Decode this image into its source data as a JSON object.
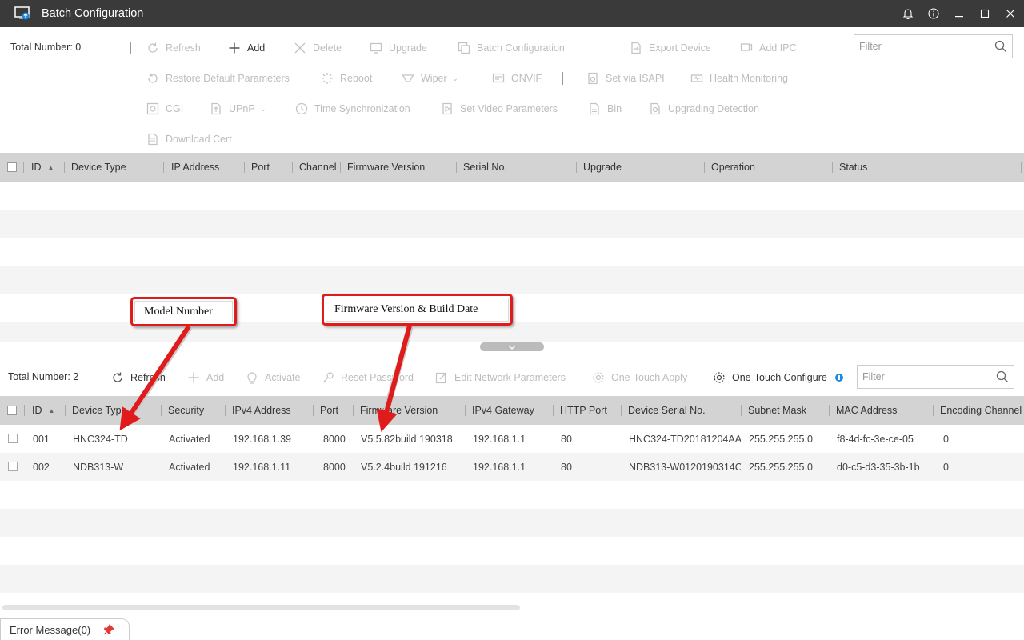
{
  "window": {
    "title": "Batch Configuration"
  },
  "top_section": {
    "total_label": "Total Number: 0",
    "toolbar": {
      "refresh": "Refresh",
      "add": "Add",
      "delete": "Delete",
      "upgrade": "Upgrade",
      "batch_configuration": "Batch Configuration",
      "export_device": "Export Device",
      "add_ipc": "Add IPC",
      "restore_default": "Restore Default Parameters",
      "reboot": "Reboot",
      "wiper": "Wiper",
      "onvif": "ONVIF",
      "set_via_isapi": "Set via ISAPI",
      "health_monitoring": "Health Monitoring",
      "cgi": "CGI",
      "upnp": "UPnP",
      "time_sync": "Time Synchronization",
      "set_video_params": "Set Video Parameters",
      "bin": "Bin",
      "upgrading_detection": "Upgrading Detection",
      "download_cert": "Download Cert"
    },
    "filter_placeholder": "Filter",
    "columns": [
      "ID",
      "Device Type",
      "IP Address",
      "Port",
      "Channel",
      "Firmware Version",
      "Serial No.",
      "Upgrade",
      "Operation",
      "Status"
    ]
  },
  "bottom_section": {
    "total_label": "Total Number: 2",
    "toolbar": {
      "refresh": "Refresh",
      "add": "Add",
      "activate": "Activate",
      "reset_password": "Reset Password",
      "edit_network": "Edit Network Parameters",
      "one_touch_apply": "One-Touch Apply",
      "one_touch_configure": "One-Touch Configure"
    },
    "filter_placeholder": "Filter",
    "columns": [
      "ID",
      "Device Type",
      "Security",
      "IPv4 Address",
      "Port",
      "Firmware Version",
      "IPv4 Gateway",
      "HTTP Port",
      "Device Serial No.",
      "Subnet Mask",
      "MAC Address",
      "Encoding Channel"
    ],
    "rows": [
      [
        "001",
        "HNC324-TD",
        "Activated",
        "192.168.1.39",
        "8000",
        "V5.5.82build 190318",
        "192.168.1.1",
        "80",
        "HNC324-TD20181204AA...",
        "255.255.255.0",
        "f8-4d-fc-3e-ce-05",
        "0"
      ],
      [
        "002",
        "NDB313-W",
        "Activated",
        "192.168.1.11",
        "8000",
        "V5.2.4build 191216",
        "192.168.1.1",
        "80",
        "NDB313-W0120190314C...",
        "255.255.255.0",
        "d0-c5-d3-35-3b-1b",
        "0"
      ]
    ]
  },
  "annotations": {
    "model_number": "Model Number",
    "firmware_build": "Firmware Version & Build Date"
  },
  "footer": {
    "error_message": "Error Message(0)"
  },
  "colors": {
    "titlebar": "#3a3a3a",
    "accent_blue": "#1e88e5",
    "callout_red": "#e01b1b",
    "header_gray": "#d3d3d3"
  }
}
